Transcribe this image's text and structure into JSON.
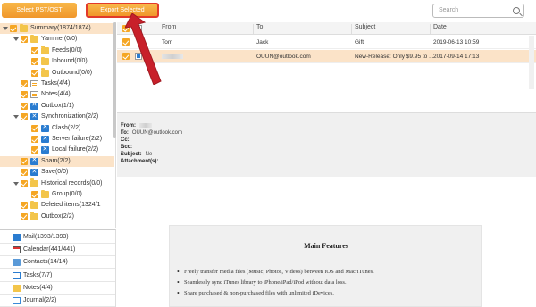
{
  "toolbar": {
    "select_label": "Select PST/OST",
    "export_label": "Export Selected",
    "search_placeholder": "Search"
  },
  "tree": [
    {
      "label": "Summary(1874/1874)",
      "level": 0,
      "toggle": "down",
      "icon": "folder",
      "selected": true
    },
    {
      "label": "Yammer(0/0)",
      "level": 1,
      "toggle": "down",
      "icon": "folder"
    },
    {
      "label": "Feeds(0/0)",
      "level": 2,
      "toggle": "",
      "icon": "folder"
    },
    {
      "label": "Inbound(0/0)",
      "level": 2,
      "toggle": "",
      "icon": "folder"
    },
    {
      "label": "Outbound(0/0)",
      "level": 2,
      "toggle": "",
      "icon": "folder"
    },
    {
      "label": "Tasks(4/4)",
      "level": 1,
      "toggle": "",
      "icon": "note"
    },
    {
      "label": "Notes(4/4)",
      "level": 1,
      "toggle": "",
      "icon": "note"
    },
    {
      "label": "Outbox(1/1)",
      "level": 1,
      "toggle": "",
      "icon": "exch"
    },
    {
      "label": "Synchronization(2/2)",
      "level": 1,
      "toggle": "down",
      "icon": "exch"
    },
    {
      "label": "Clash(2/2)",
      "level": 2,
      "toggle": "",
      "icon": "exch"
    },
    {
      "label": "Server failure(2/2)",
      "level": 2,
      "toggle": "",
      "icon": "exch"
    },
    {
      "label": "Local failure(2/2)",
      "level": 2,
      "toggle": "",
      "icon": "exch"
    },
    {
      "label": "Spam(2/2)",
      "level": 1,
      "toggle": "",
      "icon": "exch",
      "selected": true
    },
    {
      "label": "Save(0/0)",
      "level": 1,
      "toggle": "",
      "icon": "exch"
    },
    {
      "label": "Historical records(0/0)",
      "level": 1,
      "toggle": "down",
      "icon": "folder"
    },
    {
      "label": "Group(0/0)",
      "level": 2,
      "toggle": "",
      "icon": "folder"
    },
    {
      "label": "Deleted items(1324/1",
      "level": 1,
      "toggle": "",
      "icon": "folder"
    },
    {
      "label": "Outbox(2/2)",
      "level": 1,
      "toggle": "",
      "icon": "folder"
    }
  ],
  "nav": [
    {
      "label": "Mail(1393/1393)",
      "icon": "mail"
    },
    {
      "label": "Calendar(441/441)",
      "icon": "cal"
    },
    {
      "label": "Contacts(14/14)",
      "icon": "contact"
    },
    {
      "label": "Tasks(7/7)",
      "icon": "task"
    },
    {
      "label": "Notes(4/4)",
      "icon": "notes"
    },
    {
      "label": "Journal(2/2)",
      "icon": "journal"
    }
  ],
  "list": {
    "headers": {
      "from": "From",
      "to": "To",
      "subject": "Subject",
      "date": "Date"
    },
    "rows": [
      {
        "from": "Tom",
        "to": "Jack",
        "subject": "Gift",
        "date": "2019-06-13 10:59",
        "active": false
      },
      {
        "from": "",
        "to": "OUUN@outlook.com",
        "subject": "New-Release: Only $9.95 to ...",
        "date": "2017-09-14 17:13",
        "active": true
      }
    ]
  },
  "header_pane": {
    "from_k": "From:",
    "from_v": "",
    "to_k": "To:",
    "to_v": "OUUN@outlook.com",
    "cc_k": "Cc:",
    "cc_v": "",
    "bcc_k": "Bcc:",
    "bcc_v": "",
    "subject_k": "Subject:",
    "subject_v": "Ne",
    "attach_k": "Attachment(s):",
    "attach_v": ""
  },
  "doc": {
    "title": "Main Features",
    "items": [
      "Freely transfer media files (Music, Photos, Videos) between iOS and Mac/iTunes.",
      "Seamlessly sync iTunes library to iPhone/iPad/iPod without data loss.",
      "Share purchased & non-purchased files with unlimited iDevices."
    ]
  },
  "colors": {
    "accent": "#f5a623",
    "selection": "#fbe3c8",
    "arrow": "#c8202a"
  }
}
